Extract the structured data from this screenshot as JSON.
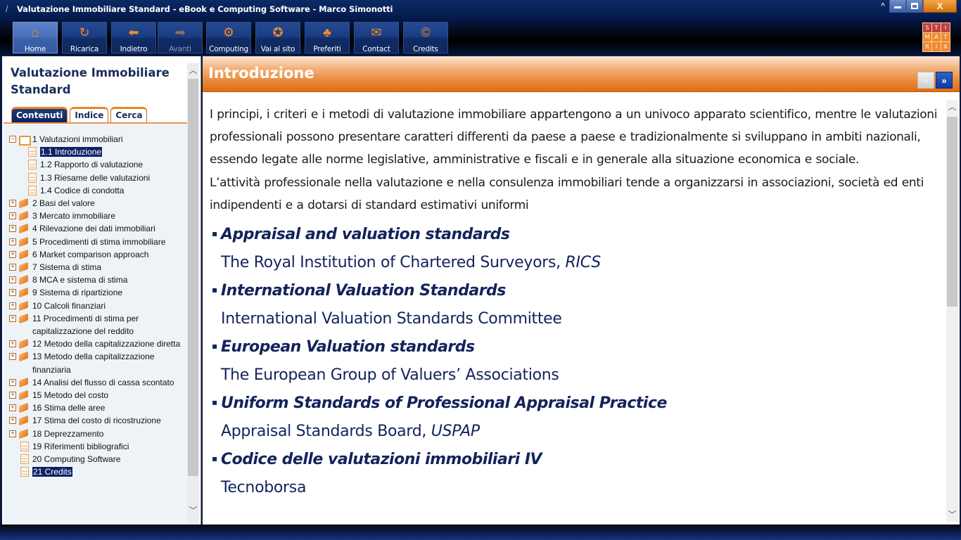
{
  "window": {
    "title": "Valutazione Immobiliare Standard - eBook e Computing Software - Marco Simonotti",
    "controls": {
      "minimize": "minimize",
      "restore": "restore",
      "close": "X"
    }
  },
  "toolbar": {
    "buttons": [
      {
        "label": "Home",
        "icon": "home-icon",
        "glyph": "⌂",
        "active": true,
        "disabled": false
      },
      {
        "label": "Ricarica",
        "icon": "refresh-icon",
        "glyph": "↻",
        "active": false,
        "disabled": false
      },
      {
        "label": "Indietro",
        "icon": "back-arrow-icon",
        "glyph": "⬅",
        "active": false,
        "disabled": false
      },
      {
        "label": "Avanti",
        "icon": "forward-arrow-icon",
        "glyph": "➡",
        "active": false,
        "disabled": true
      },
      {
        "label": "Computing",
        "icon": "gears-icon",
        "glyph": "⚙",
        "active": false,
        "disabled": false
      },
      {
        "label": "Vai al sito",
        "icon": "globe-icon",
        "glyph": "✪",
        "active": false,
        "disabled": false
      },
      {
        "label": "Preferiti",
        "icon": "tree-icon",
        "glyph": "♣",
        "active": false,
        "disabled": false
      },
      {
        "label": "Contact",
        "icon": "envelope-icon",
        "glyph": "✉",
        "active": false,
        "disabled": false
      },
      {
        "label": "Credits",
        "icon": "credits-icon",
        "glyph": "©",
        "active": false,
        "disabled": false
      }
    ],
    "logo": [
      "S",
      "T",
      "I",
      "M",
      "A",
      "T",
      "R",
      "I",
      "X"
    ]
  },
  "sidebar": {
    "title": "Valutazione Immobiliare Standard",
    "tabs": [
      {
        "label": "Contenuti",
        "active": true
      },
      {
        "label": "Indice",
        "active": false
      },
      {
        "label": "Cerca",
        "active": false
      }
    ],
    "tree": [
      {
        "label": "1 Valutazioni immobiliari",
        "type": "book-open",
        "toggle": "−",
        "level": 0
      },
      {
        "label": "1.1 Introduzione",
        "type": "page",
        "level": 1,
        "selected": true
      },
      {
        "label": "1.2 Rapporto di valutazione",
        "type": "page",
        "level": 1
      },
      {
        "label": "1.3 Riesame delle valutazioni",
        "type": "page",
        "level": 1
      },
      {
        "label": "1.4 Codice di condotta",
        "type": "page",
        "level": 1
      },
      {
        "label": "2 Basi del valore",
        "type": "book",
        "toggle": "+",
        "level": 0
      },
      {
        "label": "3 Mercato immobiliare",
        "type": "book",
        "toggle": "+",
        "level": 0
      },
      {
        "label": "4 Rilevazione dei dati immobiliari",
        "type": "book",
        "toggle": "+",
        "level": 0
      },
      {
        "label": "5 Procedimenti di stima immobiliare",
        "type": "book",
        "toggle": "+",
        "level": 0
      },
      {
        "label": "6 Market comparison approach",
        "type": "book",
        "toggle": "+",
        "level": 0
      },
      {
        "label": "7 Sistema di stima",
        "type": "book",
        "toggle": "+",
        "level": 0
      },
      {
        "label": "8 MCA e sistema di stima",
        "type": "book",
        "toggle": "+",
        "level": 0
      },
      {
        "label": "9 Sistema di ripartizione",
        "type": "book",
        "toggle": "+",
        "level": 0
      },
      {
        "label": "10 Calcoli finanziari",
        "type": "book",
        "toggle": "+",
        "level": 0
      },
      {
        "label": "11 Procedimenti di stima per capitalizzazione del reddito",
        "type": "book",
        "toggle": "+",
        "level": 0
      },
      {
        "label": "12 Metodo della capitalizzazione diretta",
        "type": "book",
        "toggle": "+",
        "level": 0
      },
      {
        "label": "13 Metodo della capitalizzazione finanziaria",
        "type": "book",
        "toggle": "+",
        "level": 0
      },
      {
        "label": "14 Analisi del flusso di cassa scontato",
        "type": "book",
        "toggle": "+",
        "level": 0
      },
      {
        "label": "15 Metodo del costo",
        "type": "book",
        "toggle": "+",
        "level": 0
      },
      {
        "label": "16 Stima delle aree",
        "type": "book",
        "toggle": "+",
        "level": 0
      },
      {
        "label": "17 Stima del costo di ricostruzione",
        "type": "book",
        "toggle": "+",
        "level": 0
      },
      {
        "label": "18 Deprezzamento",
        "type": "book",
        "toggle": "+",
        "level": 0
      },
      {
        "label": "19 Riferimenti bibliografici",
        "type": "page-top",
        "level": 0
      },
      {
        "label": "20 Computing Software",
        "type": "page-top",
        "level": 0
      },
      {
        "label": "21 Credits",
        "type": "page-top",
        "level": 0,
        "selected": true
      }
    ]
  },
  "content": {
    "title": "Introduzione",
    "nav": {
      "prev": "«",
      "next": "»"
    },
    "paragraphs": [
      "I principi, i criteri e i metodi di valutazione immobiliare appartengono a un univoco apparato scientifico, mentre le valutazioni professionali possono presentare caratteri differenti da paese a paese e tradizionalmente si sviluppano in ambiti nazionali, essendo legate alle norme legislative, amministrative e fiscali e in generale alla situazione economica e sociale.",
      "L’attività professionale nella valutazione e nella consulenza immobiliari tende a organizzarsi in associazioni, società ed enti indipendenti e a dotarsi di standard estimativi uniformi"
    ],
    "standards": [
      {
        "title": "Appraisal and valuation standards",
        "source": "The Royal Institution of Chartered Surveyors, ",
        "abbr": "RICS"
      },
      {
        "title": "International Valuation Standards",
        "source": "International Valuation Standards Committee",
        "abbr": ""
      },
      {
        "title": "European Valuation standards",
        "source": "The European Group of Valuers’ Associations",
        "abbr": ""
      },
      {
        "title": "Uniform Standards of Professional Appraisal Practice",
        "source": "Appraisal Standards Board, ",
        "abbr": "USPAP"
      },
      {
        "title": "Codice delle valutazioni immobiliari IV",
        "source": "Tecnoborsa",
        "abbr": ""
      }
    ]
  },
  "colors": {
    "navy": "#13235c",
    "orange": "#e06c12",
    "selection": "#0d2268"
  }
}
